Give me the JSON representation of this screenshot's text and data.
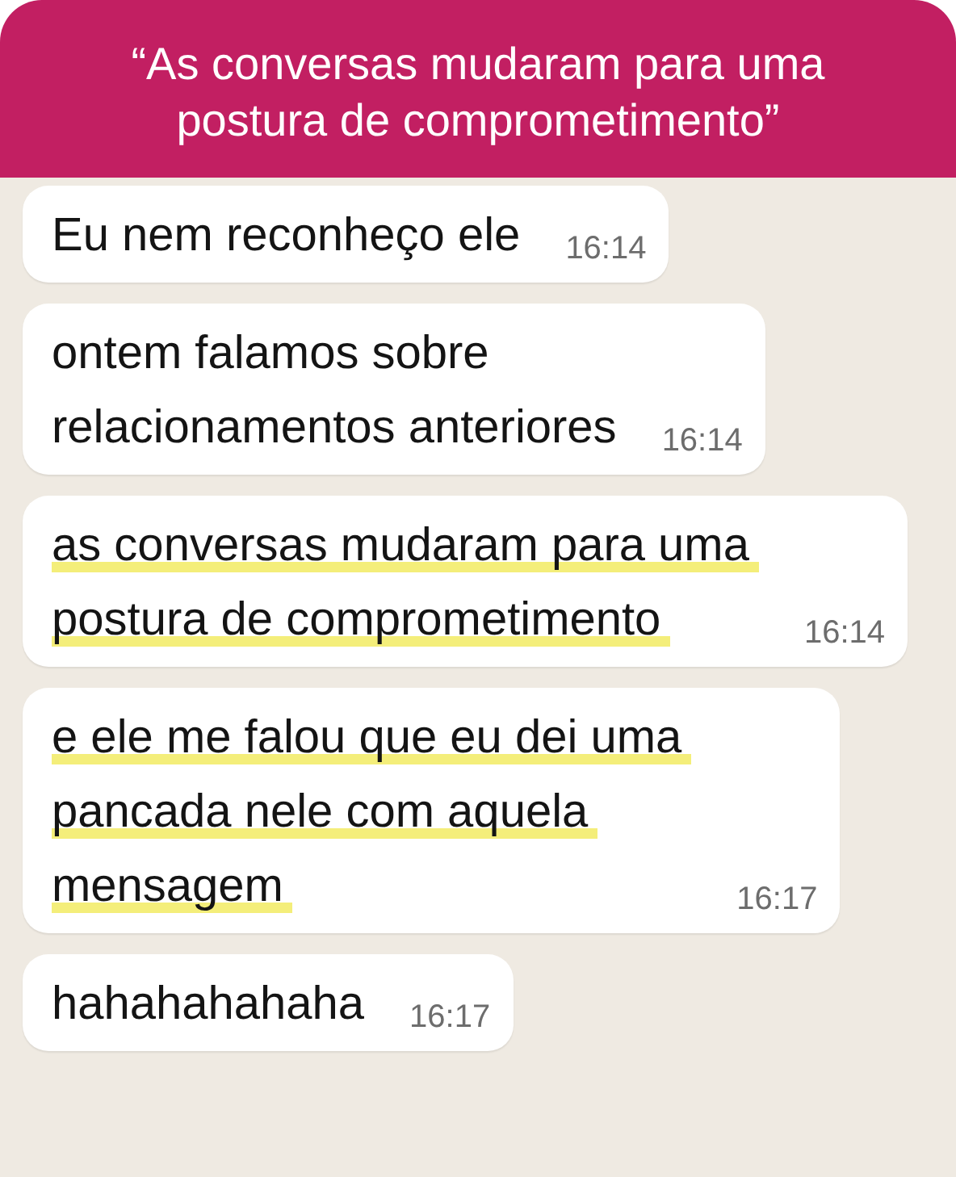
{
  "header": {
    "title": "“As conversas mudaram para uma postura de comprometimento”"
  },
  "messages": [
    {
      "lines": [
        {
          "text": "Eu nem reconheço ele",
          "highlighted": false
        }
      ],
      "time": "16:14"
    },
    {
      "lines": [
        {
          "text": "ontem falamos sobre",
          "highlighted": false
        },
        {
          "text": "relacionamentos anteriores",
          "highlighted": false
        }
      ],
      "time": "16:14"
    },
    {
      "lines": [
        {
          "text": "as conversas mudaram para uma",
          "highlighted": true
        },
        {
          "text": "postura de comprometimento",
          "highlighted": true
        }
      ],
      "time": "16:14"
    },
    {
      "lines": [
        {
          "text": "e ele me falou que eu dei uma",
          "highlighted": true
        },
        {
          "text": "pancada nele com aquela",
          "highlighted": true
        },
        {
          "text": "mensagem",
          "highlighted": true
        }
      ],
      "time": "16:17"
    },
    {
      "lines": [
        {
          "text": "hahahahahaha",
          "highlighted": false
        }
      ],
      "time": "16:17"
    }
  ]
}
